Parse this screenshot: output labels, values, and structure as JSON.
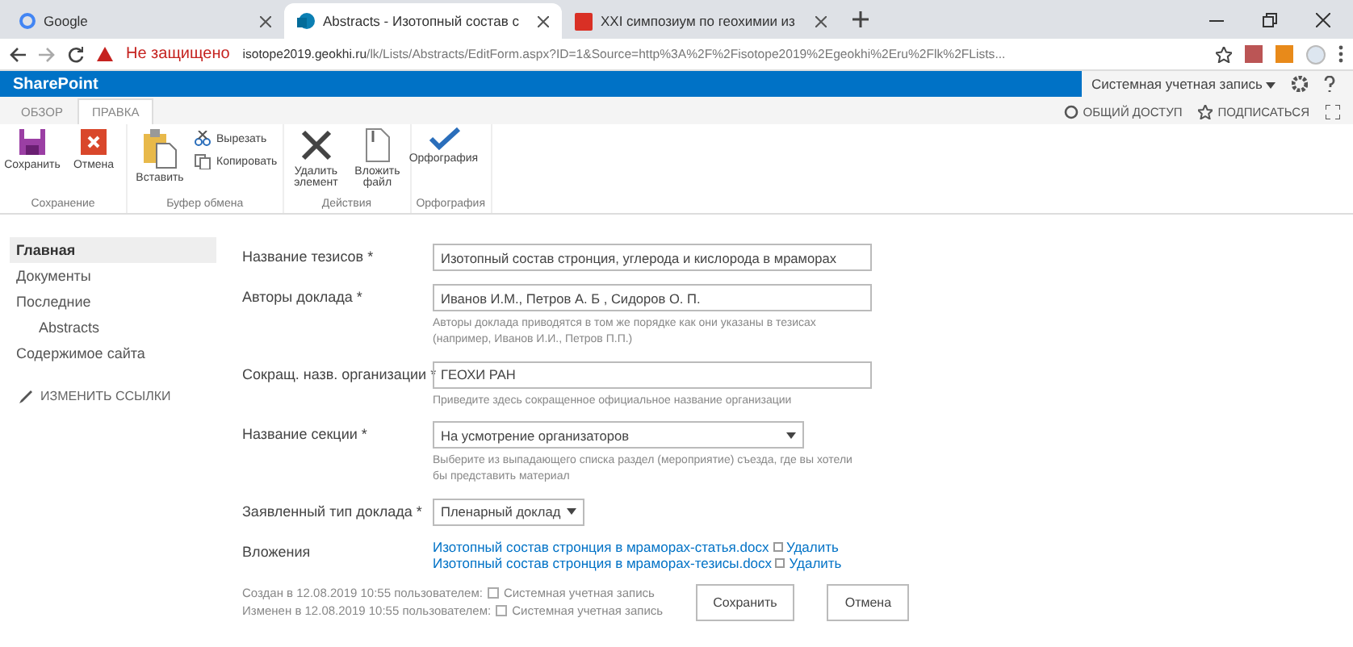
{
  "browser": {
    "tabs": [
      {
        "title": "Google",
        "selected": false
      },
      {
        "title": "Abstracts - Изотопный состав с",
        "selected": true
      },
      {
        "title": "XXI симпозиум по геохимии из",
        "selected": false
      }
    ],
    "security": "Не защищено",
    "url_host": "isotope2019.geokhi.ru",
    "url_path": "/lk/Lists/Abstracts/EditForm.aspx?ID=1&Source=http%3A%2F%2Fisotope2019%2Egeokhi%2Eru%2Flk%2FLists..."
  },
  "suite_bar": {
    "brand": "SharePoint",
    "user": "Системная учетная запись"
  },
  "ribbon_tabs": [
    {
      "label": "ОБЗОР",
      "selected": false
    },
    {
      "label": "ПРАВКА",
      "selected": true
    }
  ],
  "page_actions": [
    "ОБЩИЙ ДОСТУП",
    "ПОДПИСАТЬСЯ"
  ],
  "ribbon_groups": [
    {
      "name": "Сохранение",
      "commands": [
        {
          "label": "Сохранить",
          "kind": "large"
        },
        {
          "label": "Отмена",
          "kind": "large"
        }
      ]
    },
    {
      "name": "Буфер обмена",
      "commands": [
        {
          "label": "Вставить",
          "kind": "large"
        },
        {
          "label": "Вырезать",
          "kind": "small"
        },
        {
          "label": "Копировать",
          "kind": "small"
        }
      ]
    },
    {
      "name": "Действия",
      "commands": [
        {
          "label": "Удалить элемент",
          "kind": "large"
        },
        {
          "label": "Вложить файл",
          "kind": "large"
        }
      ]
    },
    {
      "name": "Орфография",
      "commands": [
        {
          "label": "Орфография",
          "kind": "large"
        }
      ]
    }
  ],
  "sidebar": {
    "items": [
      {
        "label": "Главная",
        "selected": true
      },
      {
        "label": "Документы",
        "selected": false
      },
      {
        "label": "Последние",
        "selected": false,
        "children": [
          {
            "label": "Abstracts",
            "selected": false
          }
        ]
      },
      {
        "label": "Содержимое сайта",
        "selected": false
      }
    ],
    "edit_links": "ИЗМЕНИТЬ ССЫЛКИ"
  },
  "form": {
    "fields": [
      {
        "label": "Название тезисов *",
        "kind": "text",
        "value": "Изотопный состав стронция, углерода и кислорода в мраморах"
      },
      {
        "label": "Авторы доклада *",
        "kind": "text",
        "value": "Иванов И.М., Петров А. Б , Сидоров О. П.",
        "hint": "Авторы доклада приводятся в том же порядке как они указаны в тезисах (например, Иванов И.И., Петров П.П.)"
      },
      {
        "label": "Сокращ. назв. организации *",
        "kind": "text",
        "value": "ГЕОХИ РАН",
        "hint": "Приведите здесь сокращенное официальное название организации"
      },
      {
        "label": "Название секции *",
        "kind": "select",
        "value": "На усмотрение организаторов",
        "hint": "Выберите из выпадающего списка раздел (мероприятие) съезда, где вы хотели бы представить материал"
      },
      {
        "label": "Заявленный тип доклада *",
        "kind": "select_small",
        "value": "Пленарный доклад"
      }
    ],
    "attachments_label": "Вложения",
    "attachments": [
      {
        "file": "Изотопный состав стронция в мраморах-статья.docx",
        "action": "Удалить"
      },
      {
        "file": "Изотопный состав стронция в мраморах-тезисы.docx",
        "action": "Удалить"
      }
    ],
    "created": {
      "text": "Создан в 12.08.2019 10:55  пользователем:",
      "user": "Системная учетная запись"
    },
    "modified": {
      "text": "Изменен в 12.08.2019 10:55  пользователем:",
      "user": "Системная учетная запись"
    },
    "buttons": [
      "Сохранить",
      "Отмена"
    ]
  }
}
